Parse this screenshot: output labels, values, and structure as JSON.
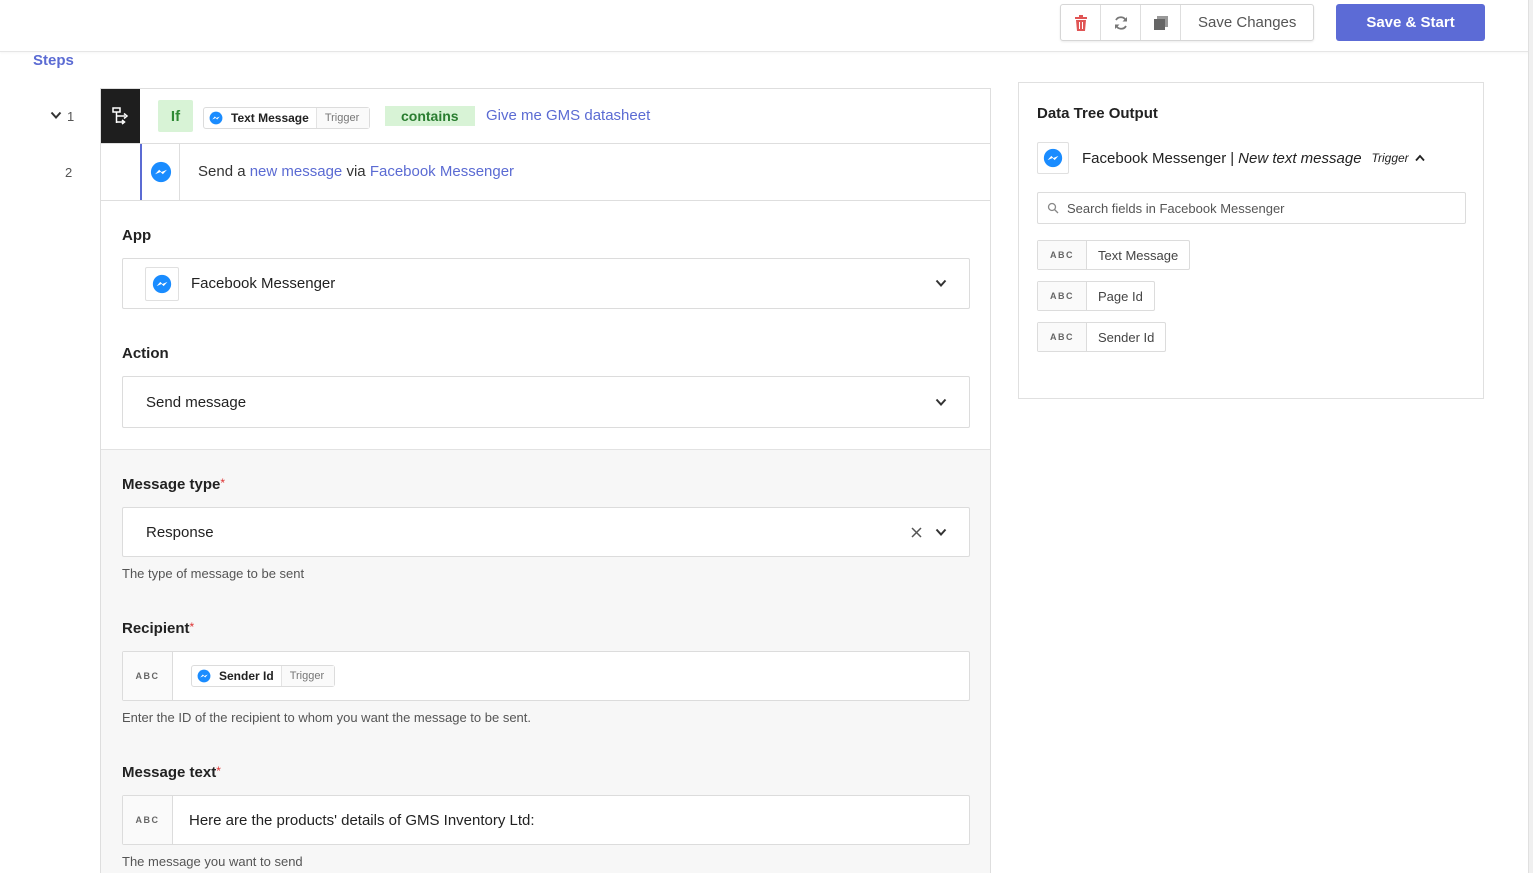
{
  "toolbar": {
    "delete_icon": "trash-icon",
    "refresh_icon": "refresh-icon",
    "copy_icon": "copy-icon",
    "save_label": "Save Changes",
    "save_start_label": "Save & Start",
    "colors": {
      "accent": "#5c6bd6",
      "delete": "#e05555"
    }
  },
  "steps": {
    "title": "Steps",
    "items": [
      {
        "number": "1",
        "if_label": "If",
        "field_chip": {
          "label": "Text Message",
          "tag": "Trigger"
        },
        "operator": "contains",
        "value": "Give me GMS datasheet"
      },
      {
        "number": "2",
        "desc_prefix": "Send a",
        "desc_action": "new message",
        "desc_via": "via",
        "desc_app": "Facebook Messenger"
      }
    ]
  },
  "config": {
    "app": {
      "label": "App",
      "value": "Facebook Messenger"
    },
    "action": {
      "label": "Action",
      "value": "Send message"
    },
    "message_type": {
      "label": "Message type",
      "required": "*",
      "value": "Response",
      "hint": "The type of message to be sent"
    },
    "recipient": {
      "label": "Recipient",
      "required": "*",
      "type": "ABC",
      "chip_label": "Sender Id",
      "chip_tag": "Trigger",
      "hint": "Enter the ID of the recipient to whom you want the message to be sent."
    },
    "message_text": {
      "label": "Message text",
      "required": "*",
      "type": "ABC",
      "value": "Here are the products' details of GMS Inventory Ltd:",
      "hint": "The message you want to send"
    }
  },
  "data_tree": {
    "title": "Data Tree Output",
    "source_app": "Facebook Messenger",
    "source_sep": "|",
    "source_event": "New text message",
    "source_tag": "Trigger",
    "search_placeholder": "Search fields in Facebook Messenger",
    "fields": [
      {
        "type": "ABC",
        "name": "Text Message"
      },
      {
        "type": "ABC",
        "name": "Page Id"
      },
      {
        "type": "ABC",
        "name": "Sender Id"
      }
    ]
  }
}
